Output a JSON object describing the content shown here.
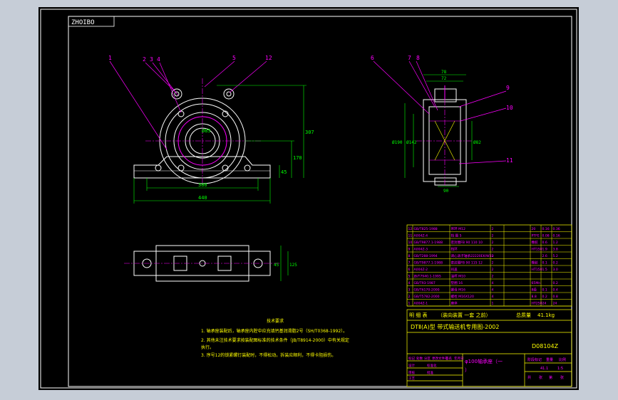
{
  "stamp": "ZHOIBO",
  "colors": {
    "background": "#000000",
    "outline": "#ffffff",
    "dimension": "#00ff00",
    "centerline": "#ff00ff",
    "leader": "#ff00ff",
    "table": "#ffff00",
    "table_text": "#ff00ff",
    "frame": "#ffffff"
  },
  "left_view": {
    "callouts": [
      "1",
      "2",
      "3",
      "4",
      "5",
      "12"
    ],
    "dims": {
      "bore": "Ø85",
      "height_total": "307",
      "center_height": "170",
      "base_height": "45",
      "bolt_pitch": "380",
      "base_length": "440"
    }
  },
  "right_view": {
    "callouts": [
      "6",
      "7",
      "8",
      "9",
      "10",
      "11"
    ],
    "dims": {
      "width_top": "78",
      "width_inner": "72",
      "outer_dia": "Ø190",
      "inner_dia": "Ø142",
      "shaft_dia": "Ø82",
      "bottom": "90"
    }
  },
  "plan_view": {
    "dims": {
      "width": "125",
      "height": "45"
    }
  },
  "tech_requirements": {
    "title": "技术要求",
    "items": [
      "1. 轴承座装配后，轴承座内腔中应充填钙基润滑脂2号（SH/T0368-1992）。",
      "2. 其他未注技术要求按装配图标准的技术条件（JB/T8914-2000）中有关规定",
      "   执行。",
      "3. 序号12的锁紧螺钉装配时，不得松动。拆装应顺利，不得卡阻损伤。"
    ]
  },
  "parts_list": {
    "rows": [
      {
        "no": "12",
        "code": "GB/T825-1988",
        "name": "吊环 M12",
        "qty": "2",
        "mat": "20",
        "w1": "0.16",
        "w2": "0.36"
      },
      {
        "no": "11",
        "code": "A004Z-4",
        "name": "挡 圈 5",
        "qty": "2",
        "mat": "PTFE",
        "w1": "0.08",
        "w2": "0.16"
      },
      {
        "no": "10",
        "code": "GB/T9877.1-1988",
        "name": "密封圈FB 90 110 10",
        "qty": "2",
        "mat": "橡胶",
        "w1": "0.6",
        "w2": "1.2"
      },
      {
        "no": "9",
        "code": "A004Z-3",
        "name": "挡环",
        "qty": "2",
        "mat": "HT150",
        "w1": "1.9",
        "w2": "3.8"
      },
      {
        "no": "8",
        "code": "GB/T288-1994",
        "name": "调心滚子轴承22220EK/W33",
        "qty": "2",
        "mat": "",
        "w1": "2.6",
        "w2": "5.2"
      },
      {
        "no": "7",
        "code": "GB/T9877.1-1988",
        "name": "密封圈FB 90 115 12",
        "qty": "2",
        "mat": "橡胶",
        "w1": "0.1",
        "w2": "0.2"
      },
      {
        "no": "6",
        "code": "A004Z-2",
        "name": "闷盖",
        "qty": "2",
        "mat": "HT150",
        "w1": "1.5",
        "w2": "3.0"
      },
      {
        "no": "5",
        "code": "JB/T7940.1-1995",
        "name": "油杯 M10",
        "qty": "2",
        "mat": "",
        "w1": "",
        "w2": ""
      },
      {
        "no": "4",
        "code": "GB/T93-1987",
        "name": "垫圈 16",
        "qty": "4",
        "mat": "65Mn",
        "w1": "",
        "w2": "0.2"
      },
      {
        "no": "3",
        "code": "GB/T6170-2000",
        "name": "螺母 M16",
        "qty": "4",
        "mat": "8级",
        "w1": "0.1",
        "w2": "0.4"
      },
      {
        "no": "2",
        "code": "GB/T5782-2000",
        "name": "螺栓 M16X120",
        "qty": "4",
        "mat": "8.8",
        "w1": "0.2",
        "w2": "0.8"
      },
      {
        "no": "1",
        "code": "A004Z-1",
        "name": "座体",
        "qty": "1",
        "mat": "HT250",
        "w1": "24",
        "w2": "24"
      }
    ],
    "header": {
      "name": "明 细 表",
      "sub": "（装向装置  一套  之前）",
      "weight_label": "总质量",
      "weight_value": "41.1kg"
    }
  },
  "title_block": {
    "project": "DTⅡ(A)型   带式输送机专用图-2002",
    "drawing_no": "D08104Z",
    "part_name": "φ100轴承座（一",
    "part_name2": "）",
    "labels": [
      "标记",
      "处数",
      "分区",
      "更改文件号",
      "签名",
      "年月日"
    ],
    "roles": [
      "设计",
      "审核",
      "工艺",
      "标准化",
      "批准"
    ],
    "scale_labels": [
      "阶段标记",
      "重量",
      "比例"
    ],
    "scale_value": "1:5",
    "weight_value": "41.1",
    "sheet": [
      "共",
      "张",
      "第",
      "张"
    ]
  }
}
